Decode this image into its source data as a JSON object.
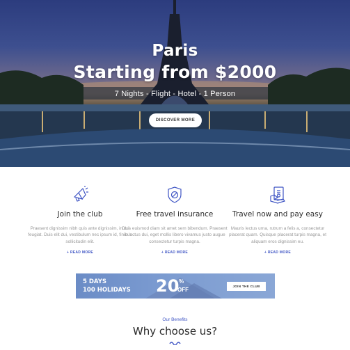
{
  "hero": {
    "title_line1": "Paris",
    "title_line2": "Starting from $2000",
    "subtitle": "7 Nights - Flight - Hotel - 1 Person",
    "button_label": "DISCOVER MORE"
  },
  "features": [
    {
      "icon": "megaphone-icon",
      "title": "Join the club",
      "description": "Praesent dignissim nibh quis ante dignissim, in dui feugiat. Duis elit dui, vestibulum nec ipsum id, finibus sollicitudin elit.",
      "link": "+ READ MORE"
    },
    {
      "icon": "shield-icon",
      "title": "Free travel insurance",
      "description": "Duis euismod diam sit amet sem bibendum. Praesent in luctus dui, eget mollis libero vivamus justo augue consectetur turpis magna.",
      "link": "+ READ MORE"
    },
    {
      "icon": "money-icon",
      "title": "Travel now and pay easy",
      "description": "Mauris lectus urna, rutrum a felis a, consectetur placerat quam. Quisque placerat turpis magna, et aliquam eros dignissim eu.",
      "link": "+ READ MORE"
    }
  ],
  "banner": {
    "line1": "5 DAYS",
    "line2": "100 HOLIDAYS",
    "percent": "20",
    "percent_sign": "%",
    "off": "OFF",
    "button_label": "JOIN THE CLUB"
  },
  "benefits": {
    "kicker": "Our Benefits",
    "heading": "Why choose us?"
  },
  "colors": {
    "accent": "#3f55c4",
    "banner": "#7a9ad0"
  }
}
